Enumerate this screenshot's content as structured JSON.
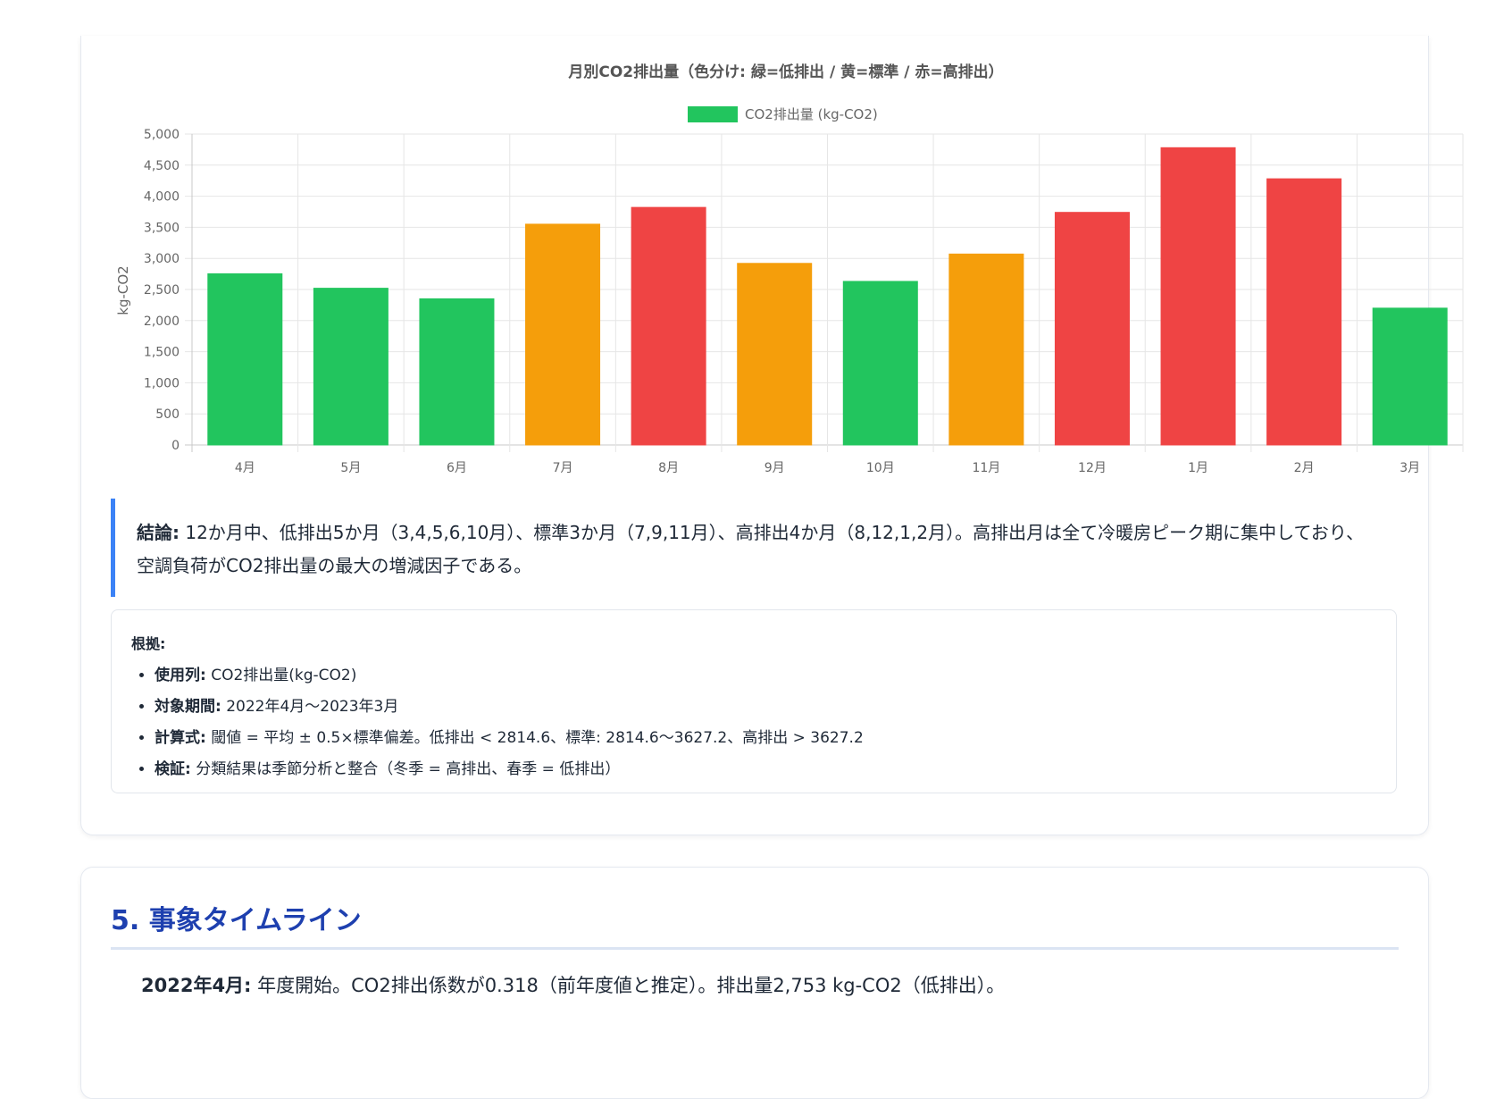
{
  "chart_data": {
    "type": "bar",
    "title": "月別CO2排出量（色分け: 緑=低排出 / 黄=標準 / 赤=高排出）",
    "legend": {
      "label": "CO2排出量 (kg-CO2)",
      "color": "#22c55e",
      "position": "top-center"
    },
    "ylabel": "kg-CO2",
    "xlabel": "",
    "ylim": [
      0,
      5000
    ],
    "yticks": [
      0,
      500,
      1000,
      1500,
      2000,
      2500,
      3000,
      3500,
      4000,
      4500,
      5000
    ],
    "ytick_labels": [
      "0",
      "500",
      "1,000",
      "1,500",
      "2,000",
      "2,500",
      "3,000",
      "3,500",
      "4,000",
      "4,500",
      "5,000"
    ],
    "grid": true,
    "categories": [
      "4月",
      "5月",
      "6月",
      "7月",
      "8月",
      "9月",
      "10月",
      "11月",
      "12月",
      "1月",
      "2月",
      "3月"
    ],
    "values": [
      2753,
      2520,
      2350,
      3550,
      3820,
      2920,
      2630,
      3070,
      3740,
      4780,
      4280,
      2200
    ],
    "bar_colors": [
      "#22c55e",
      "#22c55e",
      "#22c55e",
      "#f59e0b",
      "#ef4444",
      "#f59e0b",
      "#22c55e",
      "#f59e0b",
      "#ef4444",
      "#ef4444",
      "#ef4444",
      "#22c55e"
    ]
  },
  "conclusion": {
    "label": "結論:",
    "text": " 12か月中、低排出5か月（3,4,5,6,10月）、標準3か月（7,9,11月）、高排出4か月（8,12,1,2月）。高排出月は全て冷暖房ピーク期に集中しており、空調負荷がCO2排出量の最大の増減因子である。"
  },
  "basis": {
    "title": "根拠:",
    "items": [
      {
        "label": "使用列:",
        "text": " CO2排出量(kg-CO2)"
      },
      {
        "label": "対象期間:",
        "text": " 2022年4月〜2023年3月"
      },
      {
        "label": "計算式:",
        "text": " 閾値 = 平均 ± 0.5×標準偏差。低排出 < 2814.6、標準: 2814.6〜3627.2、高排出 > 3627.2"
      },
      {
        "label": "検証:",
        "text": " 分類結果は季節分析と整合（冬季 = 高排出、春季 = 低排出）"
      }
    ]
  },
  "timeline": {
    "section_title": "5. 事象タイムライン",
    "items": [
      {
        "label": "2022年4月:",
        "text": " 年度開始。CO2排出係数が0.318（前年度値と推定）。排出量2,753 kg-CO2（低排出）。"
      }
    ]
  }
}
